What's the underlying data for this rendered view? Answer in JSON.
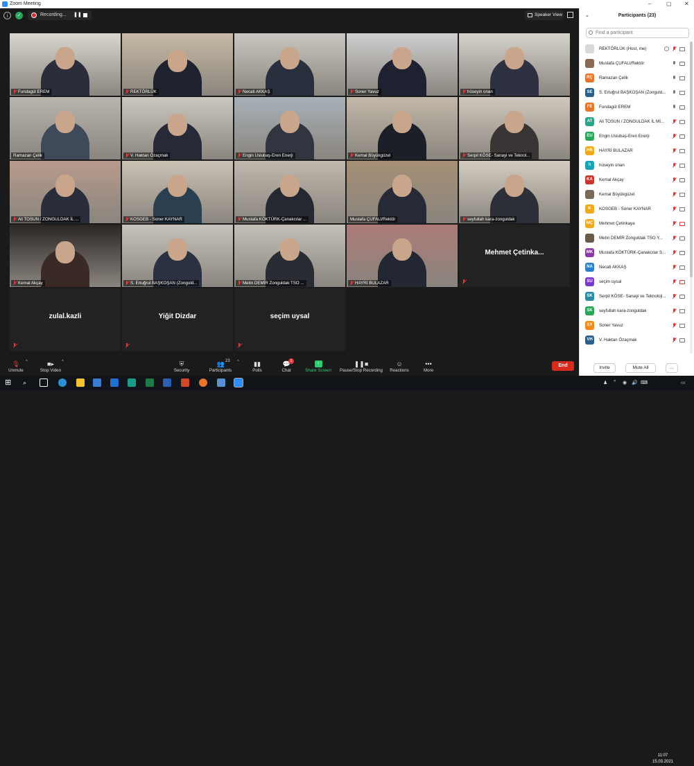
{
  "window": {
    "title": "Zoom Meeting"
  },
  "top_bar": {
    "recording_label": "Recording...",
    "speaker_view_label": "Speaker View"
  },
  "tiles": [
    {
      "name": "Fundagül EREM",
      "muted": true
    },
    {
      "name": "REKTÖRLÜK",
      "muted": true
    },
    {
      "name": "Necati AKKAŞ",
      "muted": true
    },
    {
      "name": "Soner Yavuz",
      "muted": true
    },
    {
      "name": "hüseyin onan",
      "muted": true
    },
    {
      "name": "Ramazan Çelik",
      "muted": false
    },
    {
      "name": "V. Haktan Özaçmak",
      "muted": true
    },
    {
      "name": "Engin Uslubaş-Eren Enerji",
      "muted": true
    },
    {
      "name": "Kemal Büyükgüzel",
      "muted": true
    },
    {
      "name": "Serpil KÖSE- Sanayi ve Teknol...",
      "muted": true
    },
    {
      "name": "Ali TOSUN / ZONGULDAK İL ...",
      "muted": true
    },
    {
      "name": "KOSGEB - Soner KAYNAR",
      "muted": true
    },
    {
      "name": "Mustafa KÖKTÜRK-Çanakcılar ...",
      "muted": true
    },
    {
      "name": "Mustafa ÇUFALI/Rektör",
      "muted": false,
      "active": true
    },
    {
      "name": "seyfullah kara-zonguldak",
      "muted": true
    },
    {
      "name": "Kemal Akçay",
      "muted": true
    },
    {
      "name": "S. Ertuğrul BAŞKOŞAN (Zonguld...",
      "muted": true
    },
    {
      "name": "Metin DEMİR Zonguldak TSO ...",
      "muted": true
    },
    {
      "name": "HAYRİ BULAZAR",
      "muted": true
    },
    {
      "name": "Mehmet  Çetinka...",
      "muted": true,
      "video_off": true
    },
    {
      "name": "zulal.kazli",
      "muted": true,
      "video_off": true
    },
    {
      "name": "Yiğit Dizdar",
      "muted": true,
      "video_off": true
    },
    {
      "name": "seçim uysal",
      "muted": true,
      "video_off": true
    }
  ],
  "toolbar": {
    "unmute": "Unmute",
    "stop_video": "Stop Video",
    "security": "Security",
    "participants": "Participants",
    "participants_count": "23",
    "polls": "Polls",
    "chat": "Chat",
    "chat_badge": "1",
    "share_screen": "Share Screen",
    "pause_recording": "Pause/Stop Recording",
    "reactions": "Reactions",
    "more": "More",
    "end": "End"
  },
  "panel": {
    "title": "Participants (23)",
    "search_placeholder": "Find a participant",
    "invite": "Invite",
    "mute_all": "Mute All",
    "more": "...",
    "participants": [
      {
        "initials": "",
        "name": "REKTÖRLÜK (Host, me)",
        "color": "#d9d9d9",
        "muted": true,
        "video": true,
        "host": true
      },
      {
        "initials": "",
        "name": "Mustafa ÇUFALI/Rektör",
        "color": "#8a6a55",
        "muted": false,
        "video": true
      },
      {
        "initials": "RÇ",
        "name": "Ramazan Çelik",
        "color": "#e8742a",
        "muted": false,
        "video": true
      },
      {
        "initials": "SE",
        "name": "S. Ertuğrul BAŞKOŞAN (Zonguld...",
        "color": "#2b5f8a",
        "muted": false,
        "video": true
      },
      {
        "initials": "FE",
        "name": "Fundagül EREM",
        "color": "#e8742a",
        "muted": false,
        "video": true
      },
      {
        "initials": "AT",
        "name": "Ali TOSUN / ZONGULDAK İL Mİ...",
        "color": "#2aa58a",
        "muted": true,
        "video": true
      },
      {
        "initials": "EU",
        "name": "Engin Uslubaş-Eren Enerji",
        "color": "#2aa55a",
        "muted": true,
        "video": true
      },
      {
        "initials": "HB",
        "name": "HAYRİ BULAZAR",
        "color": "#f2a81d",
        "muted": true,
        "video": true
      },
      {
        "initials": "h",
        "name": "hüseyin onan",
        "color": "#1aa3b5",
        "muted": true,
        "video": true
      },
      {
        "initials": "KA",
        "name": "Kemal Akçay",
        "color": "#c9362d",
        "muted": true,
        "video": true
      },
      {
        "initials": "",
        "name": "Kemal Büyükgüzel",
        "color": "#7a6a5a",
        "muted": true,
        "video": true
      },
      {
        "initials": "K",
        "name": "KOSGEB - Soner KAYNAR",
        "color": "#f2a81d",
        "muted": true,
        "video": true
      },
      {
        "initials": "MÇ",
        "name": "Mehmet Çetinkaya",
        "color": "#f2a81d",
        "muted": true,
        "video": false
      },
      {
        "initials": "",
        "name": "Metin DEMİR Zonguldak TSO Y...",
        "color": "#6a5a4a",
        "muted": true,
        "video": true
      },
      {
        "initials": "MK",
        "name": "Mustafa KÖKTÜRK-Çanakcılar S...",
        "color": "#8a3aa5",
        "muted": true,
        "video": true
      },
      {
        "initials": "NA",
        "name": "Necati AKKAŞ",
        "color": "#2b7fc9",
        "muted": true,
        "video": true
      },
      {
        "initials": "SU",
        "name": "seçim uysal",
        "color": "#7a3ac9",
        "muted": true,
        "video": false
      },
      {
        "initials": "SK",
        "name": "Serpil KÖSE- Sanayi ve Teknoloji...",
        "color": "#2a8aa5",
        "muted": true,
        "video": true
      },
      {
        "initials": "SK",
        "name": "seyfullah kara-zonguldak",
        "color": "#2aa55a",
        "muted": true,
        "video": true
      },
      {
        "initials": "SY",
        "name": "Soner Yavuz",
        "color": "#f28a1d",
        "muted": true,
        "video": true
      },
      {
        "initials": "VH",
        "name": "V. Haktan Özaçmak",
        "color": "#2b5f8a",
        "muted": true,
        "video": true
      }
    ]
  },
  "taskbar": {
    "time": "11:07",
    "date": "15.03.2021"
  }
}
